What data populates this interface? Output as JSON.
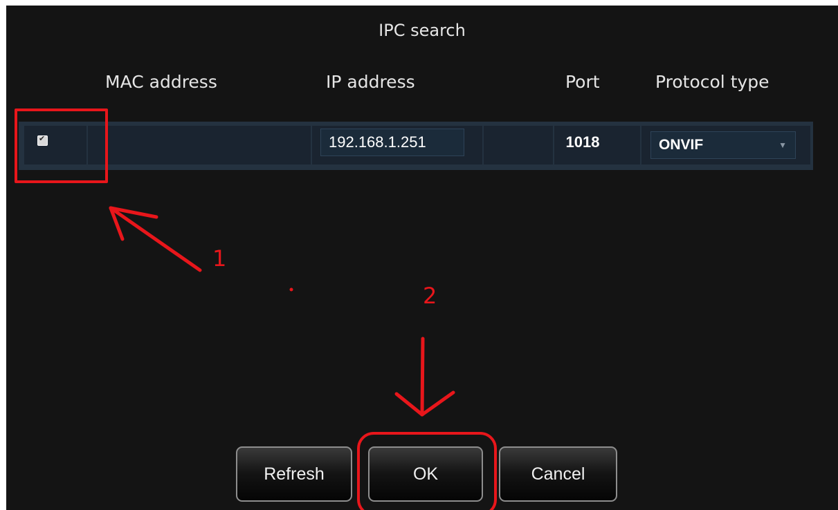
{
  "dialog": {
    "title": "IPC search"
  },
  "table": {
    "columns": [
      "MAC address",
      "IP address",
      "Port",
      "Protocol type"
    ],
    "rows": [
      {
        "checked": true,
        "mac": "",
        "ip": "192.168.1.251",
        "port": "1018",
        "protocol": "ONVIF"
      }
    ]
  },
  "buttons": {
    "refresh": "Refresh",
    "ok": "OK",
    "cancel": "Cancel"
  },
  "annotations": {
    "step1": "1",
    "step2": "2",
    "color": "#e8161b"
  },
  "colors": {
    "background": "#141414",
    "row": "#243240",
    "text": "#e6e6e6"
  }
}
